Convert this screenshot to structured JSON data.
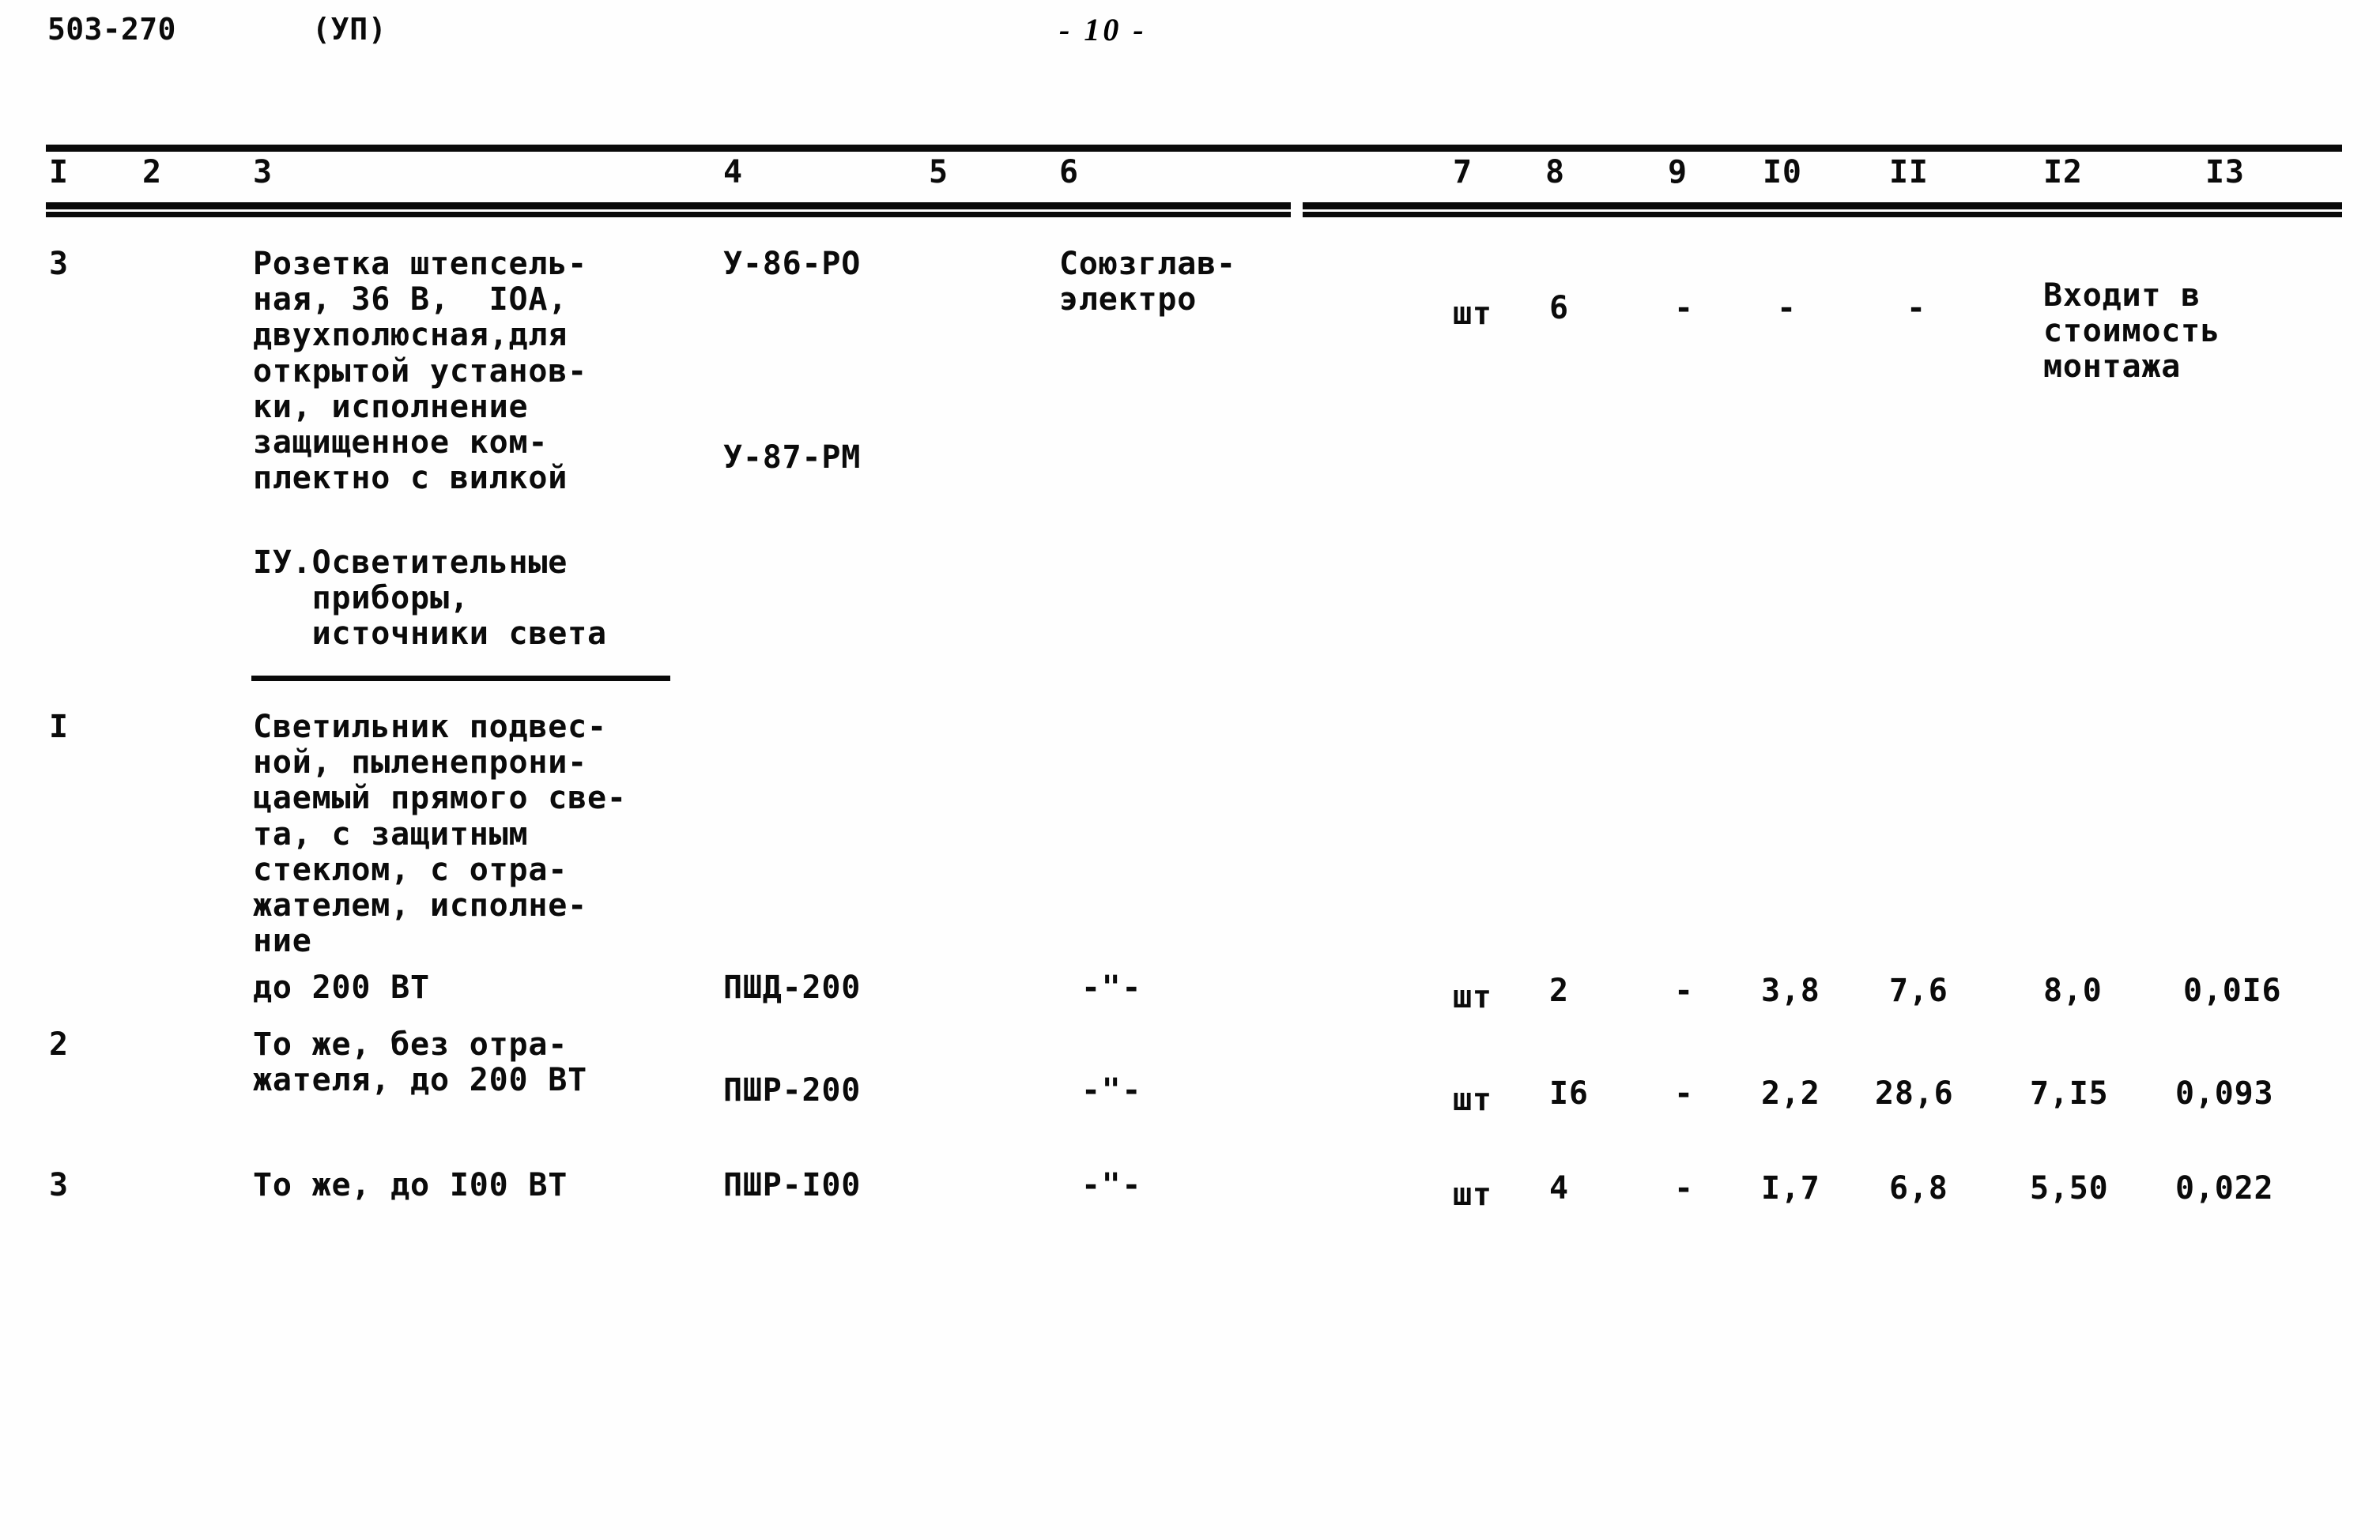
{
  "header": {
    "doc_code": "503-270",
    "series": "(УП)",
    "page_number": "- 10 -"
  },
  "table": {
    "column_headers": [
      "I",
      "2",
      "3",
      "4",
      "5",
      "6",
      "7",
      "8",
      "9",
      "I0",
      "II",
      "I2",
      "I3"
    ],
    "rows": [
      {
        "num": "3",
        "description": "Розетка штепсель-\nная, 36 В,  IОА,\nдвухполюсная,для\nоткрытой установ-\nки, исполнение\nзащищенное ком-\nплектно с вилкой",
        "type_1": "У-86-РО",
        "type_2": "У-87-РМ",
        "supplier": "Союзглав-\nэлектро",
        "unit": "шт",
        "qty": "6",
        "col9": "-",
        "col10": "-",
        "col11": "-",
        "col12": "Входит в\nстоимость\nмонтажа",
        "col13": ""
      },
      {
        "num": "",
        "section_heading": "IУ.Осветительные\n   приборы,\n   источники света"
      },
      {
        "num": "I",
        "description": "Светильник подвес-\nной, пыленепрони-\nцаемый прямого све-\nта, с защитным\nстеклом, с отра-\nжателем, исполне-\nние",
        "subline": "до 200 ВТ",
        "type_1": "ПШД-200",
        "supplier": "-\"-",
        "unit": "шт",
        "qty": "2",
        "col9": "-",
        "col10": "3,8",
        "col11": "7,6",
        "col12": "8,0",
        "col13": "0,0I6"
      },
      {
        "num": "2",
        "description": "То же, без отра-\nжателя, до 200 ВТ",
        "type_1": "ПШР-200",
        "supplier": "-\"-",
        "unit": "шт",
        "qty": "I6",
        "col9": "-",
        "col10": "2,2",
        "col11": "28,6",
        "col12": "7,I5",
        "col13": "0,093"
      },
      {
        "num": "3",
        "description": "То же, до I00 ВТ",
        "type_1": "ПШР-I00",
        "supplier": "-\"-",
        "unit": "шт",
        "qty": "4",
        "col9": "-",
        "col10": "I,7",
        "col11": "6,8",
        "col12": "5,50",
        "col13": "0,022"
      }
    ]
  }
}
